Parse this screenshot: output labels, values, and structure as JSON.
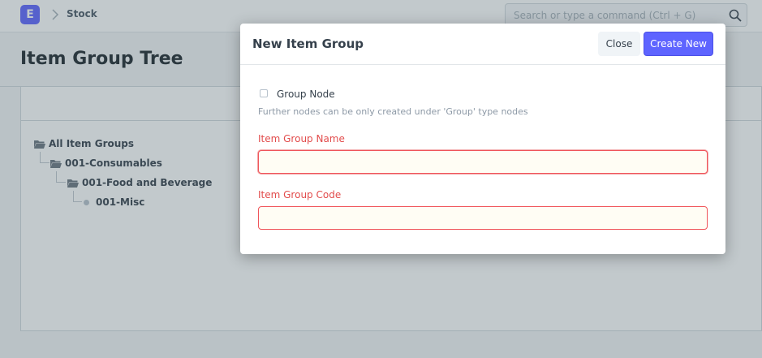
{
  "navbar": {
    "logo_letter": "E",
    "breadcrumb": "Stock",
    "search_placeholder": "Search or type a command (Ctrl + G)"
  },
  "page": {
    "title": "Item Group Tree"
  },
  "tree": {
    "nodes": [
      {
        "label": "All Item Groups",
        "type": "folder-open"
      },
      {
        "label": "001-Consumables",
        "type": "folder-open"
      },
      {
        "label": "001-Food and Beverage",
        "type": "folder-open"
      },
      {
        "label": "001-Misc",
        "type": "leaf"
      }
    ]
  },
  "modal": {
    "title": "New Item Group",
    "close_label": "Close",
    "primary_label": "Create New",
    "group_node_label": "Group Node",
    "group_node_checked": false,
    "group_node_help": "Further nodes can be only created under 'Group' type nodes",
    "fields": [
      {
        "label": "Item Group Name",
        "value": ""
      },
      {
        "label": "Item Group Code",
        "value": ""
      }
    ]
  },
  "colors": {
    "primary": "#5e64ff",
    "required_label": "#e24c4c",
    "required_border": "#f0555a"
  }
}
